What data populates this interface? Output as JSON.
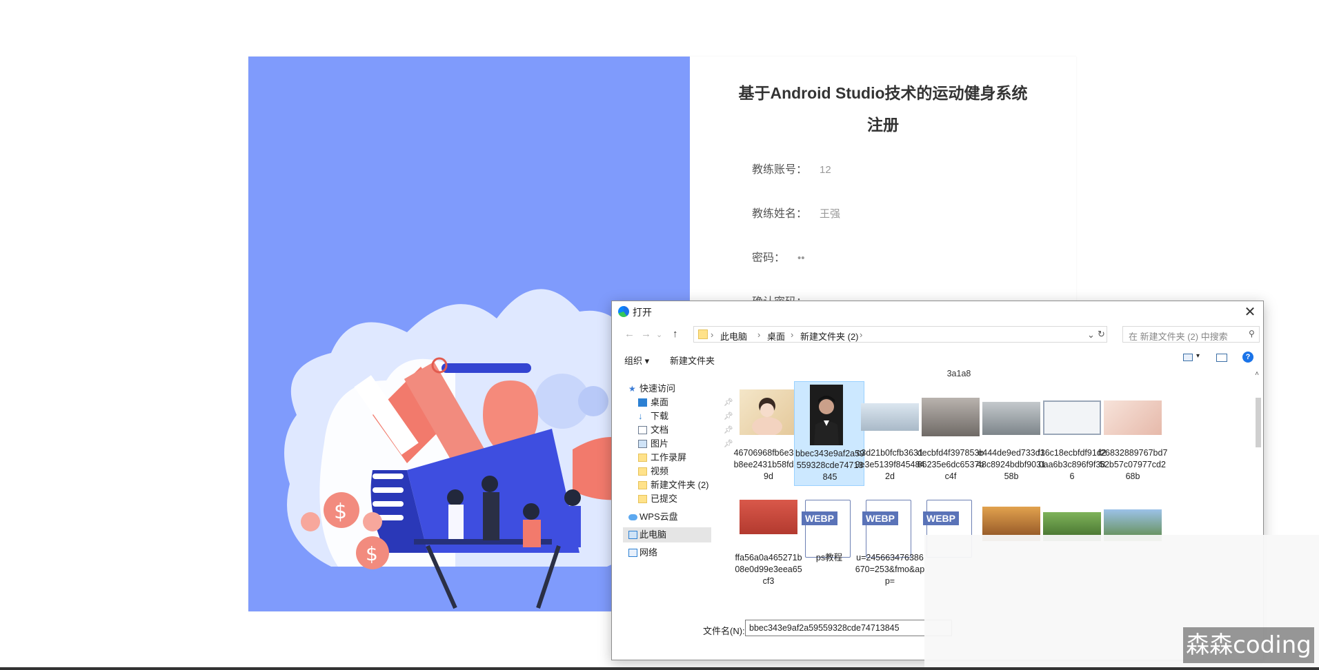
{
  "form": {
    "title": "基于Android Studio技术的运动健身系统注册",
    "fields": [
      {
        "label": "教练账号：",
        "value": "12"
      },
      {
        "label": "教练姓名：",
        "value": "王强"
      },
      {
        "label": "密码：",
        "value": "••"
      },
      {
        "label": "确认密码：",
        "value": "••"
      }
    ]
  },
  "dialog": {
    "title": "打开",
    "close_glyph": "✕",
    "breadcrumbs": [
      "此电脑",
      "桌面",
      "新建文件夹 (2)"
    ],
    "search_placeholder": "在 新建文件夹 (2) 中搜索",
    "toolbar": {
      "organize": "组织 ▾",
      "new_folder": "新建文件夹"
    },
    "group_header": "3a1a8",
    "sidebar": [
      {
        "label": "快速访问",
        "icon": "star-icon"
      },
      {
        "label": "桌面",
        "icon": "desktop-icon",
        "pinned": true
      },
      {
        "label": "下载",
        "icon": "download-icon",
        "pinned": true
      },
      {
        "label": "文档",
        "icon": "document-icon",
        "pinned": true
      },
      {
        "label": "图片",
        "icon": "picture-icon",
        "pinned": true
      },
      {
        "label": "工作录屏",
        "icon": "folder-icon"
      },
      {
        "label": "视频",
        "icon": "folder-icon"
      },
      {
        "label": "新建文件夹 (2)",
        "icon": "folder-icon"
      },
      {
        "label": "已提交",
        "icon": "folder-icon"
      },
      {
        "label": "WPS云盘",
        "icon": "cloud-icon"
      },
      {
        "label": "此电脑",
        "icon": "computer-icon",
        "selected": true
      },
      {
        "label": "网络",
        "icon": "network-icon"
      }
    ],
    "files": [
      {
        "name": "46706968fb6e3e1b8ee2431b58fd409d",
        "kind": "photo-woman",
        "color": "#e8d8b8"
      },
      {
        "name": "bbec343e9af2a59559328cde74713845",
        "kind": "photo-man",
        "color": "#2b2b2b",
        "selected": true
      },
      {
        "name": "c3d21b0fcfb36319e3e5139f8454842d",
        "kind": "photo-lab",
        "color": "#b9c8d6"
      },
      {
        "name": "decbfd4f397853b86235e6dc6537bc4f",
        "kind": "photo-room",
        "color": "#8f8a86"
      },
      {
        "name": "e444de9ed733d148c8924bdbf903158b",
        "kind": "photo-equipment",
        "color": "#9ba3a8"
      },
      {
        "name": "f36c18ecbfdf91d20aa6b3c896f9f386",
        "kind": "photo-certificate",
        "color": "#dfe3ea"
      },
      {
        "name": "f26832889767bd752b57c07977cd268b",
        "kind": "photo-spa",
        "color": "#f0d6cc"
      },
      {
        "name": "ffa56a0a465271b08e0d99e3eea65cf3",
        "kind": "photo-box",
        "color": "#c9473a"
      },
      {
        "name": "ps教程",
        "kind": "webp"
      },
      {
        "name": "u=245663476386670=253&fmo&app=",
        "kind": "webp"
      },
      {
        "name": "",
        "kind": "webp"
      },
      {
        "name": "",
        "kind": "photo-hall",
        "color": "#c98a3e"
      },
      {
        "name": "",
        "kind": "photo-panda",
        "color": "#5d8a3c"
      },
      {
        "name": "",
        "kind": "photo-field",
        "color": "#6e9a5a"
      }
    ],
    "filename_label": "文件名(N):",
    "filename_value": "bbec343e9af2a59559328cde74713845"
  },
  "watermark": "森森coding",
  "colors": {
    "illustration_bg": "#7f9bfc",
    "selection": "#cce8ff",
    "accent": "#1a73e8"
  }
}
